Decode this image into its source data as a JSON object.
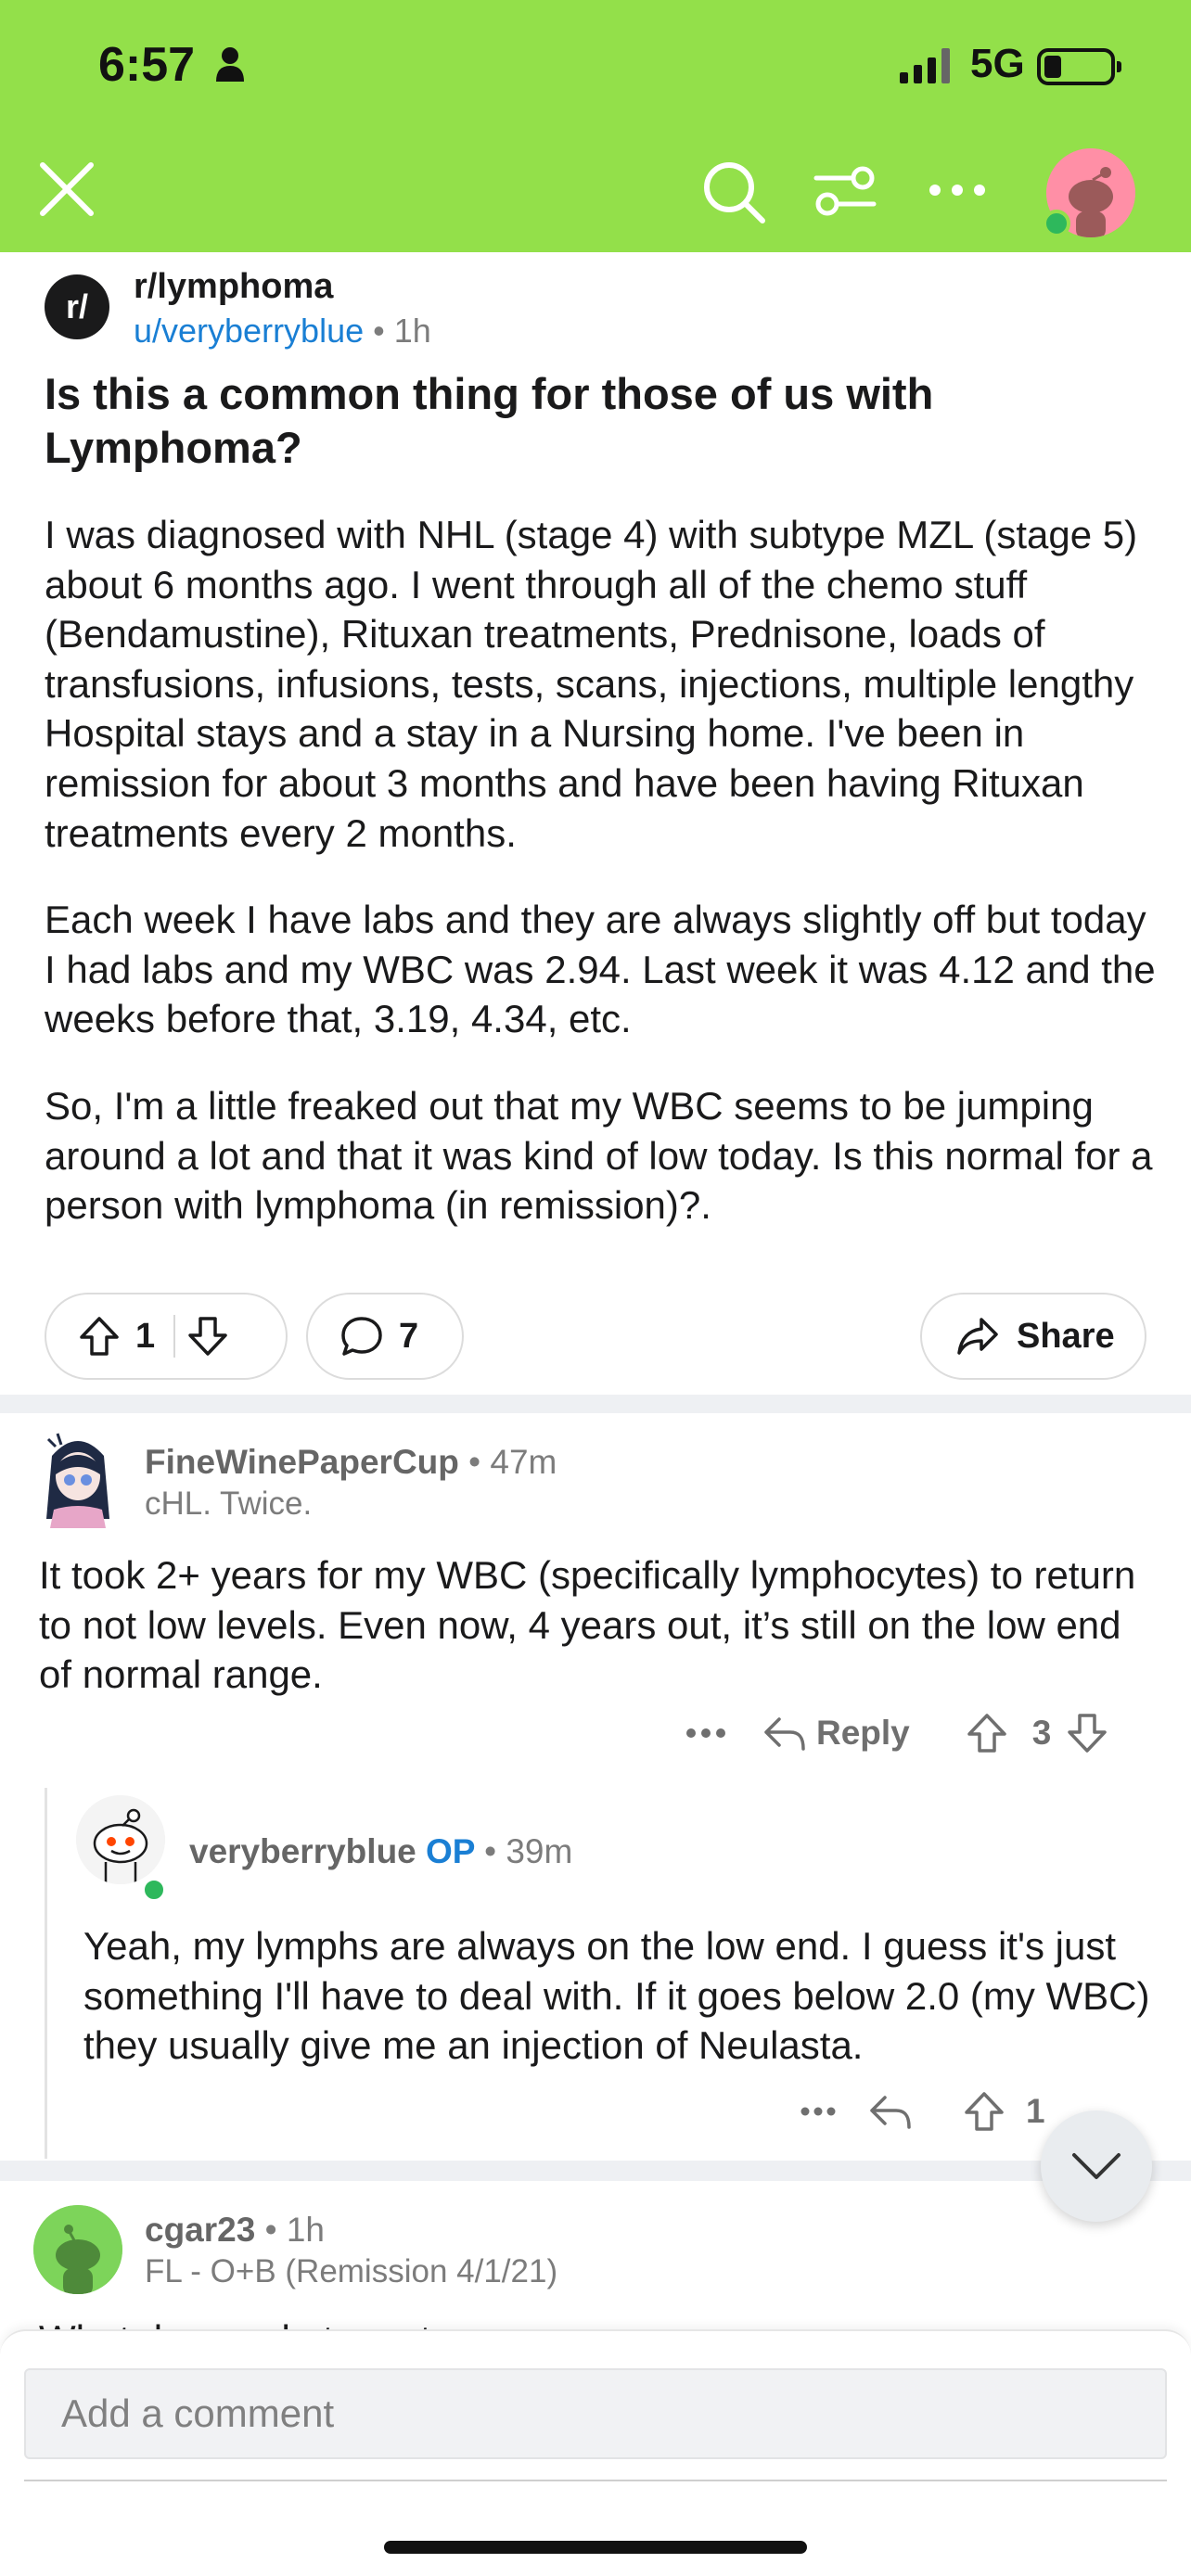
{
  "status_bar": {
    "time": "6:57",
    "network": "5G"
  },
  "header": {
    "icons": [
      "close-icon",
      "search-icon",
      "filter-icon",
      "more-icon",
      "avatar"
    ],
    "bg_color": "#93e04a"
  },
  "post": {
    "subreddit_logo": "r/",
    "subreddit": "r/lymphoma",
    "author": "u/veryberryblue",
    "separator": "•",
    "time": "1h",
    "title": "Is this a common thing for those of us with Lymphoma?",
    "paragraphs": [
      "I was diagnosed with NHL (stage 4) with subtype MZL (stage 5) about 6 months ago. I went through all of the chemo stuff (Bendamustine), Rituxan treatments, Prednisone, loads of transfusions, infusions, tests, scans, injections, multiple lengthy Hospital stays and a stay in a Nursing home. I've been in remission for about 3 months and have been having Rituxan treatments every 2 months.",
      "Each week I have labs and they are always slightly off but today I had labs and my WBC was 2.94. Last week it was 4.12 and the weeks before that, 3.19, 4.34, etc.",
      "So, I'm a little freaked out that my WBC seems to be jumping around a lot and that it was kind of low today. Is this normal for a person with lymphoma (in remission)?."
    ],
    "votes": "1",
    "comments": "7",
    "share_label": "Share"
  },
  "comments": [
    {
      "user": "FineWinePaperCup",
      "time": "47m",
      "flair": "cHL. Twice.",
      "body": "It took 2+ years for my WBC (specifically lymphocytes) to return to not low levels. Even now, 4 years out, it’s still on the low end of normal range.",
      "reply_label": "Reply",
      "votes": "3"
    },
    {
      "user": "veryberryblue",
      "op_label": "OP",
      "time": "39m",
      "body": "Yeah, my lymphs are always on the low end. I guess it's just something I'll have to deal with. If it goes below 2.0 (my WBC) they usually give me an injection of Neulasta.",
      "votes": "1"
    },
    {
      "user": "cgar23",
      "time": "1h",
      "flair": "FL - O+B (Remission 4/1/21)",
      "body_partial": "What do you do to mot..."
    }
  ],
  "composer": {
    "placeholder": "Add a comment"
  },
  "colors": {
    "link_blue": "#1a7fd4",
    "online_green": "#2eb85c",
    "avatar_pink": "#ff8fa6"
  }
}
